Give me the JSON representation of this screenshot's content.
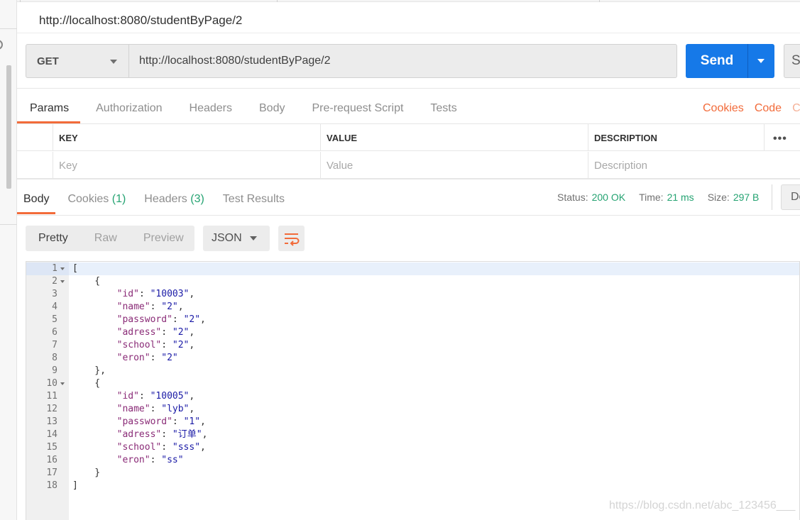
{
  "window": {
    "tab_title": "http://localhost:8080/studentByPage/2"
  },
  "request": {
    "method": "GET",
    "url": "http://localhost:8080/studentByPage/2",
    "send_label": "Send",
    "save_label": "Sa"
  },
  "request_tabs": [
    "Params",
    "Authorization",
    "Headers",
    "Body",
    "Pre-request Script",
    "Tests"
  ],
  "request_links": [
    "Cookies",
    "Code",
    "Co"
  ],
  "params_table": {
    "headers": [
      "KEY",
      "VALUE",
      "DESCRIPTION"
    ],
    "more_label": "•••",
    "placeholders": [
      "Key",
      "Value",
      "Description"
    ]
  },
  "response_tabs": {
    "body": "Body",
    "cookies": "Cookies",
    "cookies_count": "(1)",
    "headers": "Headers",
    "headers_count": "(3)",
    "tests": "Test Results"
  },
  "status": {
    "status_label": "Status:",
    "status_value": "200 OK",
    "time_label": "Time:",
    "time_value": "21 ms",
    "size_label": "Size:",
    "size_value": "297 B",
    "download_label": "De"
  },
  "view_modes": [
    "Pretty",
    "Raw",
    "Preview"
  ],
  "format": "JSON",
  "code_lines": [
    {
      "n": "1",
      "fold": true,
      "text": "["
    },
    {
      "n": "2",
      "fold": true,
      "text": "    {"
    },
    {
      "n": "3",
      "fold": false,
      "key": "id",
      "val": "10003",
      "comma": true
    },
    {
      "n": "4",
      "fold": false,
      "key": "name",
      "val": "2",
      "comma": true
    },
    {
      "n": "5",
      "fold": false,
      "key": "password",
      "val": "2",
      "comma": true
    },
    {
      "n": "6",
      "fold": false,
      "key": "adress",
      "val": "2",
      "comma": true
    },
    {
      "n": "7",
      "fold": false,
      "key": "school",
      "val": "2",
      "comma": true
    },
    {
      "n": "8",
      "fold": false,
      "key": "eron",
      "val": "2",
      "comma": false
    },
    {
      "n": "9",
      "fold": false,
      "text": "    },"
    },
    {
      "n": "10",
      "fold": true,
      "text": "    {"
    },
    {
      "n": "11",
      "fold": false,
      "key": "id",
      "val": "10005",
      "comma": true
    },
    {
      "n": "12",
      "fold": false,
      "key": "name",
      "val": "lyb",
      "comma": true
    },
    {
      "n": "13",
      "fold": false,
      "key": "password",
      "val": "1",
      "comma": true
    },
    {
      "n": "14",
      "fold": false,
      "key": "adress",
      "val": "订单",
      "comma": true
    },
    {
      "n": "15",
      "fold": false,
      "key": "school",
      "val": "sss",
      "comma": true
    },
    {
      "n": "16",
      "fold": false,
      "key": "eron",
      "val": "ss",
      "comma": false
    },
    {
      "n": "17",
      "fold": false,
      "text": "    }"
    },
    {
      "n": "18",
      "fold": false,
      "text": "]"
    }
  ],
  "watermark": "https://blog.csdn.net/abc_123456___",
  "colors": {
    "accent": "#f26b3a",
    "send": "#1679e8",
    "status_ok": "#25a372",
    "json_key": "#8a2b77",
    "json_string": "#1a1aa6"
  }
}
